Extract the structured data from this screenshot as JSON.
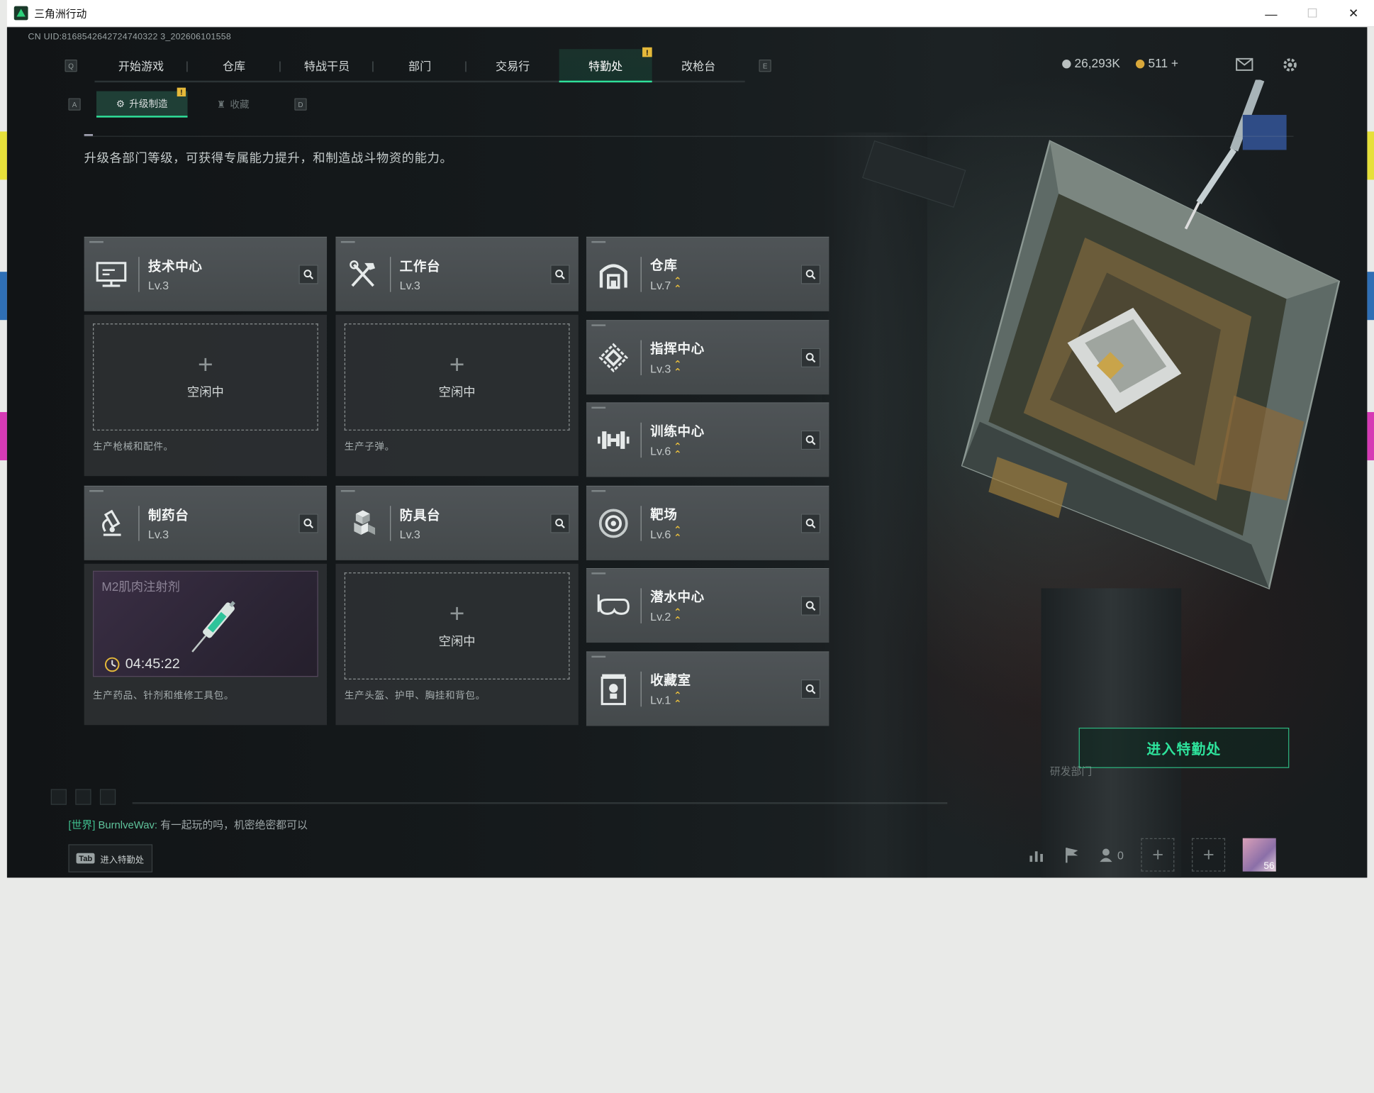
{
  "window": {
    "title": "三角洲行动",
    "minimize": "—",
    "maximize": "☐",
    "close": "✕"
  },
  "uid": "CN UID:8168542642724740322320260610155 8",
  "uid_text": "CN UID:8168542642724740322 3_202606101558",
  "nav": {
    "left_key": "Q",
    "right_key": "E",
    "tabs": [
      {
        "label": "开始游戏"
      },
      {
        "label": "仓库"
      },
      {
        "label": "特战干员"
      },
      {
        "label": "部门"
      },
      {
        "label": "交易行"
      },
      {
        "label": "特勤处",
        "active": true,
        "alert": "!"
      },
      {
        "label": "改枪台"
      }
    ]
  },
  "resources": {
    "silver": "26,293K",
    "gold": "511",
    "add": "+"
  },
  "subnav": {
    "left_key": "A",
    "right_key": "D",
    "tabs": [
      {
        "label": "升级制造",
        "alert": "!"
      },
      {
        "label": "收藏"
      }
    ]
  },
  "description": "升级各部门等级，可获得专属能力提升，和制造战斗物资的能力。",
  "production": [
    {
      "name": "技术中心",
      "level": "Lv.3",
      "icon": "computer-icon",
      "slot_state": "空闲中",
      "slot_plus": "+",
      "desc": "生产枪械和配件。"
    },
    {
      "name": "工作台",
      "level": "Lv.3",
      "icon": "tools-icon",
      "slot_state": "空闲中",
      "slot_plus": "+",
      "desc": "生产子弹。"
    },
    {
      "name": "制药台",
      "level": "Lv.3",
      "icon": "microscope-icon",
      "item": "M2肌肉注射剂",
      "timer": "04:45:22",
      "desc": "生产药品、针剂和维修工具包。"
    },
    {
      "name": "防具台",
      "level": "Lv.3",
      "icon": "boxes-icon",
      "slot_state": "空闲中",
      "slot_plus": "+",
      "desc": "生产头盔、护甲、胸挂和背包。"
    }
  ],
  "departments": [
    {
      "name": "仓库",
      "level": "Lv.7",
      "icon": "warehouse-icon",
      "upgradable": true
    },
    {
      "name": "指挥中心",
      "level": "Lv.3",
      "icon": "command-icon",
      "upgradable": true
    },
    {
      "name": "训练中心",
      "level": "Lv.6",
      "icon": "dumbbell-icon",
      "upgradable": true
    },
    {
      "name": "靶场",
      "level": "Lv.6",
      "icon": "target-icon",
      "upgradable": true
    },
    {
      "name": "潜水中心",
      "level": "Lv.2",
      "icon": "diving-mask-icon",
      "upgradable": true
    },
    {
      "name": "收藏室",
      "level": "Lv.1",
      "icon": "trophy-icon",
      "upgradable": true
    }
  ],
  "enter_button": "进入特勤处",
  "dept_watermark": "研发部门",
  "chat": {
    "channel": "[世界]",
    "user": "BurnlveWav:",
    "message": "有一起玩的吗，机密绝密都可以"
  },
  "tab_hint": {
    "key": "Tab",
    "label": "进入特勤处"
  },
  "bottom": {
    "friends_count": "0",
    "plus": "+",
    "avatar_level": "56"
  },
  "colors": {
    "accent": "#2fe09a",
    "alert": "#e5b93a",
    "card": "#4b5053"
  }
}
